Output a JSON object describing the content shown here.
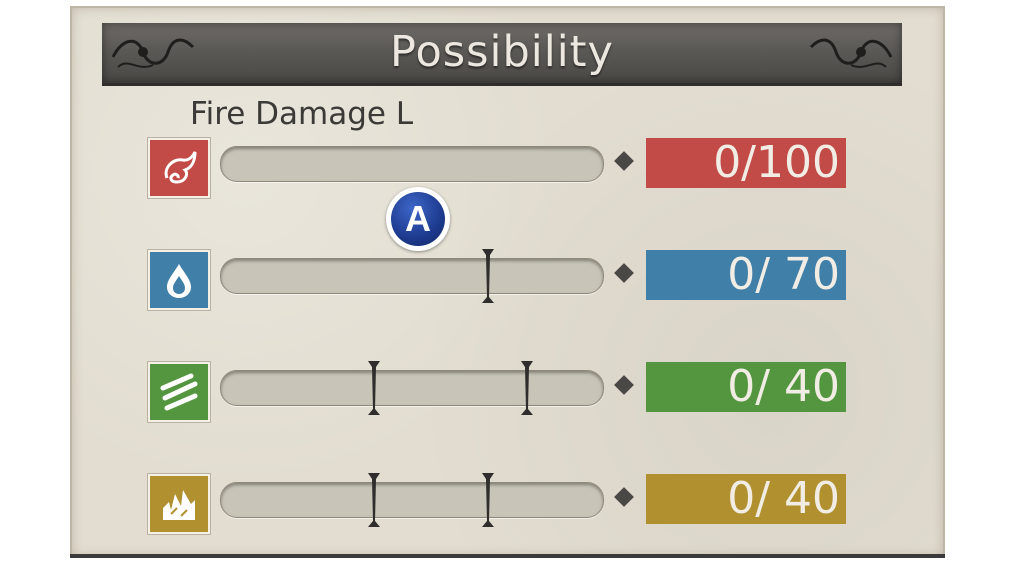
{
  "header": {
    "title": "Possibility"
  },
  "subtitle": "Fire Damage L",
  "rows": [
    {
      "element": "fire",
      "icon": "fire-swirl-icon",
      "color": "#c24a47",
      "value_text": "0/100",
      "markers": []
    },
    {
      "element": "water",
      "icon": "water-drop-icon",
      "color": "#3f7fa8",
      "value_text": "0/ 70",
      "markers": [
        70
      ]
    },
    {
      "element": "wind",
      "icon": "wind-slash-icon",
      "color": "#54963f",
      "value_text": "0/ 40",
      "markers": [
        40,
        80
      ]
    },
    {
      "element": "earth",
      "icon": "earth-rock-icon",
      "color": "#b0902f",
      "value_text": "0/ 40",
      "markers": [
        40,
        70
      ]
    }
  ],
  "badge": {
    "label": "A",
    "color": "#1d3a8e"
  }
}
